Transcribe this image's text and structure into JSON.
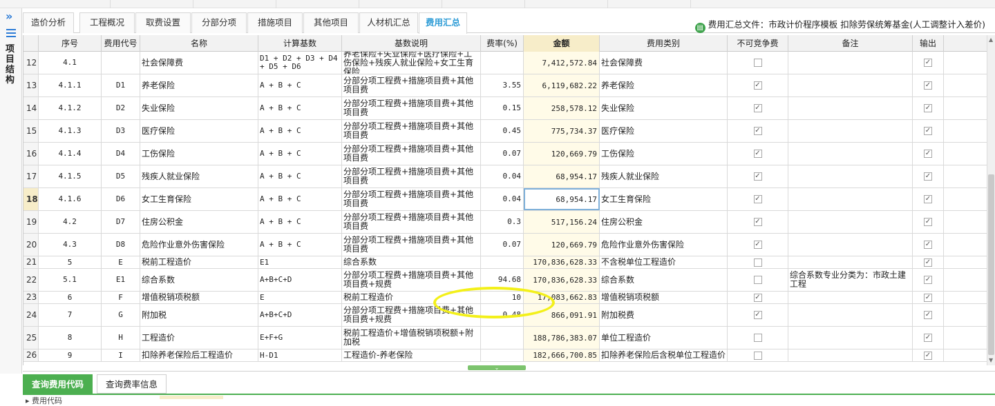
{
  "sidebar": {
    "label": "项目结构"
  },
  "tabs": [
    {
      "label": "造价分析",
      "active": false
    },
    {
      "label": "工程概况",
      "active": false
    },
    {
      "label": "取费设置",
      "active": false
    },
    {
      "label": "分部分项",
      "active": false
    },
    {
      "label": "措施项目",
      "active": false
    },
    {
      "label": "其他项目",
      "active": false
    },
    {
      "label": "人材机汇总",
      "active": false
    },
    {
      "label": "费用汇总",
      "active": true
    }
  ],
  "file_info": {
    "text": "费用汇总文件：市政计价程序模板 扣除劳保统筹基金(人工调整计入差价)"
  },
  "table": {
    "headers": [
      "序号",
      "费用代号",
      "名称",
      "计算基数",
      "基数说明",
      "费率(%)",
      "金额",
      "费用类别",
      "不可竞争费",
      "备注",
      "输出"
    ],
    "rows": [
      {
        "idx": "12",
        "seq": "4.1",
        "code": "",
        "name": "社会保障费",
        "base": "D1 + D2 + D3 + D4 + D5 + D6",
        "desc": "养老保险+失业保险+医疗保险+工伤保险+残疾人就业保险+女工生育保险",
        "rate": "",
        "amount": "7,412,572.84",
        "category": "社会保障费",
        "noncomp": false,
        "remark": "",
        "output": true
      },
      {
        "idx": "13",
        "seq": "4.1.1",
        "code": "D1",
        "name": "养老保险",
        "base": "A + B + C",
        "desc": "分部分项工程费+措施项目费+其他项目费",
        "rate": "3.55",
        "amount": "6,119,682.22",
        "category": "养老保险",
        "noncomp": true,
        "remark": "",
        "output": true
      },
      {
        "idx": "14",
        "seq": "4.1.2",
        "code": "D2",
        "name": "失业保险",
        "base": "A + B + C",
        "desc": "分部分项工程费+措施项目费+其他项目费",
        "rate": "0.15",
        "amount": "258,578.12",
        "category": "失业保险",
        "noncomp": true,
        "remark": "",
        "output": true
      },
      {
        "idx": "15",
        "seq": "4.1.3",
        "code": "D3",
        "name": "医疗保险",
        "base": "A + B + C",
        "desc": "分部分项工程费+措施项目费+其他项目费",
        "rate": "0.45",
        "amount": "775,734.37",
        "category": "医疗保险",
        "noncomp": true,
        "remark": "",
        "output": true
      },
      {
        "idx": "16",
        "seq": "4.1.4",
        "code": "D4",
        "name": "工伤保险",
        "base": "A + B + C",
        "desc": "分部分项工程费+措施项目费+其他项目费",
        "rate": "0.07",
        "amount": "120,669.79",
        "category": "工伤保险",
        "noncomp": true,
        "remark": "",
        "output": true
      },
      {
        "idx": "17",
        "seq": "4.1.5",
        "code": "D5",
        "name": "残疾人就业保险",
        "base": "A + B + C",
        "desc": "分部分项工程费+措施项目费+其他项目费",
        "rate": "0.04",
        "amount": "68,954.17",
        "category": "残疾人就业保险",
        "noncomp": true,
        "remark": "",
        "output": true
      },
      {
        "idx": "18",
        "seq": "4.1.6",
        "code": "D6",
        "name": "女工生育保险",
        "base": "A + B + C",
        "desc": "分部分项工程费+措施项目费+其他项目费",
        "rate": "0.04",
        "amount": "68,954.17",
        "category": "女工生育保险",
        "noncomp": true,
        "remark": "",
        "output": true,
        "selected": true
      },
      {
        "idx": "19",
        "seq": "4.2",
        "code": "D7",
        "name": "住房公积金",
        "base": "A + B + C",
        "desc": "分部分项工程费+措施项目费+其他项目费",
        "rate": "0.3",
        "amount": "517,156.24",
        "category": "住房公积金",
        "noncomp": true,
        "remark": "",
        "output": true
      },
      {
        "idx": "20",
        "seq": "4.3",
        "code": "D8",
        "name": "危险作业意外伤害保险",
        "base": "A + B + C",
        "desc": "分部分项工程费+措施项目费+其他项目费",
        "rate": "0.07",
        "amount": "120,669.79",
        "category": "危险作业意外伤害保险",
        "noncomp": true,
        "remark": "",
        "output": true
      },
      {
        "idx": "21",
        "seq": "5",
        "code": "E",
        "name": "税前工程造价",
        "base": "E1",
        "desc": "综合系数",
        "rate": "",
        "amount": "170,836,628.33",
        "category": "不含税单位工程造价",
        "noncomp": false,
        "remark": "",
        "output": true
      },
      {
        "idx": "22",
        "seq": "5.1",
        "code": "E1",
        "name": "综合系数",
        "base": "A+B+C+D",
        "desc": "分部分项工程费+措施项目费+其他项目费+规费",
        "rate": "94.68",
        "amount": "170,836,628.33",
        "category": "综合系数",
        "noncomp": false,
        "remark": "综合系数专业分类为：市政土建工程",
        "output": true
      },
      {
        "idx": "23",
        "seq": "6",
        "code": "F",
        "name": "增值税销项税额",
        "base": "E",
        "desc": "税前工程造价",
        "rate": "10",
        "amount": "17,083,662.83",
        "category": "增值税销项税额",
        "noncomp": true,
        "remark": "",
        "output": true
      },
      {
        "idx": "24",
        "seq": "7",
        "code": "G",
        "name": "附加税",
        "base": "A+B+C+D",
        "desc": "分部分项工程费+措施项目费+其他项目费+规费",
        "rate": "0.48",
        "amount": "866,091.91",
        "category": "附加税费",
        "noncomp": true,
        "remark": "",
        "output": true
      },
      {
        "idx": "25",
        "seq": "8",
        "code": "H",
        "name": "工程造价",
        "base": "E+F+G",
        "desc": "税前工程造价+增值税销项税额+附加税",
        "rate": "",
        "amount": "188,786,383.07",
        "category": "单位工程造价",
        "noncomp": false,
        "remark": "",
        "output": true
      },
      {
        "idx": "26",
        "seq": "9",
        "code": "I",
        "name": "扣除养老保险后工程造价",
        "base": "H-D1",
        "desc": "工程造价-养老保险",
        "rate": "",
        "amount": "182,666,700.85",
        "category": "扣除养老保险后含税单位工程造价",
        "noncomp": false,
        "remark": "",
        "output": true
      }
    ]
  },
  "bottom_tabs": [
    {
      "label": "查询费用代码",
      "active": true
    },
    {
      "label": "查询费率信息",
      "active": false
    }
  ],
  "bottom_peek": {
    "label": "费用代码"
  }
}
